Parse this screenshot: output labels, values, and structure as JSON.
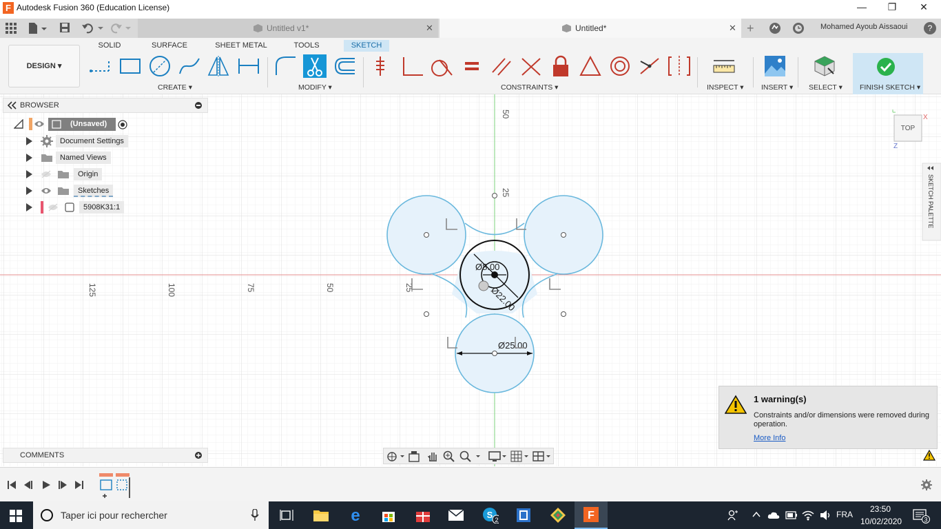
{
  "titlebar": {
    "logo": "F",
    "title": "Autodesk Fusion 360 (Education License)",
    "minimize": "—",
    "maximize": "❐",
    "close": "✕"
  },
  "tabs": [
    {
      "label": "Untitled v1*",
      "close": "✕"
    },
    {
      "label": "Untitled*",
      "close": "✕"
    }
  ],
  "user": {
    "name": "Mohamed Ayoub Aissaoui"
  },
  "toolbar": {
    "design_label": "DESIGN ▾",
    "workspace_tabs": [
      "SOLID",
      "SURFACE",
      "SHEET METAL",
      "TOOLS",
      "SKETCH"
    ],
    "groups": {
      "create": "CREATE ▾",
      "modify": "MODIFY ▾",
      "constraints": "CONSTRAINTS ▾",
      "inspect": "INSPECT ▾",
      "insert": "INSERT ▾",
      "select": "SELECT ▾",
      "finish": "FINISH SKETCH ▾"
    }
  },
  "browser": {
    "title": "BROWSER",
    "items": [
      "(Unsaved)",
      "Document Settings",
      "Named Views",
      "Origin",
      "Sketches",
      "5908K31:1"
    ]
  },
  "canvas": {
    "axis_labels": [
      "50",
      "25",
      "125",
      "100",
      "75",
      "50",
      "25"
    ],
    "dimensions": {
      "inner": "Ø8.00",
      "middle": "Ø22.00",
      "lower": "Ø25.00"
    },
    "viewcube": "TOP",
    "viewcube_z": "Z",
    "viewcube_x": "X",
    "palette": "SKETCH PALETTE"
  },
  "comments": {
    "title": "COMMENTS"
  },
  "warning": {
    "title": "1 warning(s)",
    "message": "Constraints and/or dimensions were removed during operation.",
    "link": "More Info"
  },
  "taskbar": {
    "search_placeholder": "Taper ici pour rechercher",
    "lang": "FRA",
    "time": "23:50",
    "date": "10/02/2020",
    "notif_count": "3",
    "skype_badge": "2"
  },
  "colors": {
    "accent": "#1696d6",
    "sketch_fill": "#e6f2fb",
    "sketch_stroke": "#6ab8dd",
    "taskbar": "#1c2530"
  }
}
